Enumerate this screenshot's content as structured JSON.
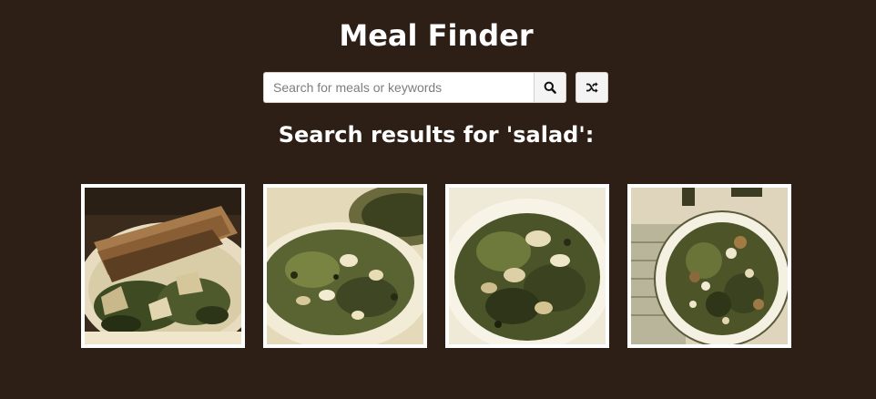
{
  "header": {
    "title": "Meal Finder"
  },
  "search": {
    "placeholder": "Search for meals or keywords",
    "value": "",
    "search_icon": "search-icon",
    "random_icon": "shuffle-icon"
  },
  "results": {
    "heading": "Search results for 'salad':",
    "meals": [
      {
        "id": "meal-1",
        "image": "salmon-salad-photo"
      },
      {
        "id": "meal-2",
        "image": "bowl-salad-photo"
      },
      {
        "id": "meal-3",
        "image": "plated-salad-photo"
      },
      {
        "id": "meal-4",
        "image": "plate-salad-photo"
      }
    ]
  },
  "colors": {
    "background": "#2d1e16",
    "text": "#ffffff",
    "card_border": "#ffffff",
    "button_bg": "#f4f4f4"
  }
}
